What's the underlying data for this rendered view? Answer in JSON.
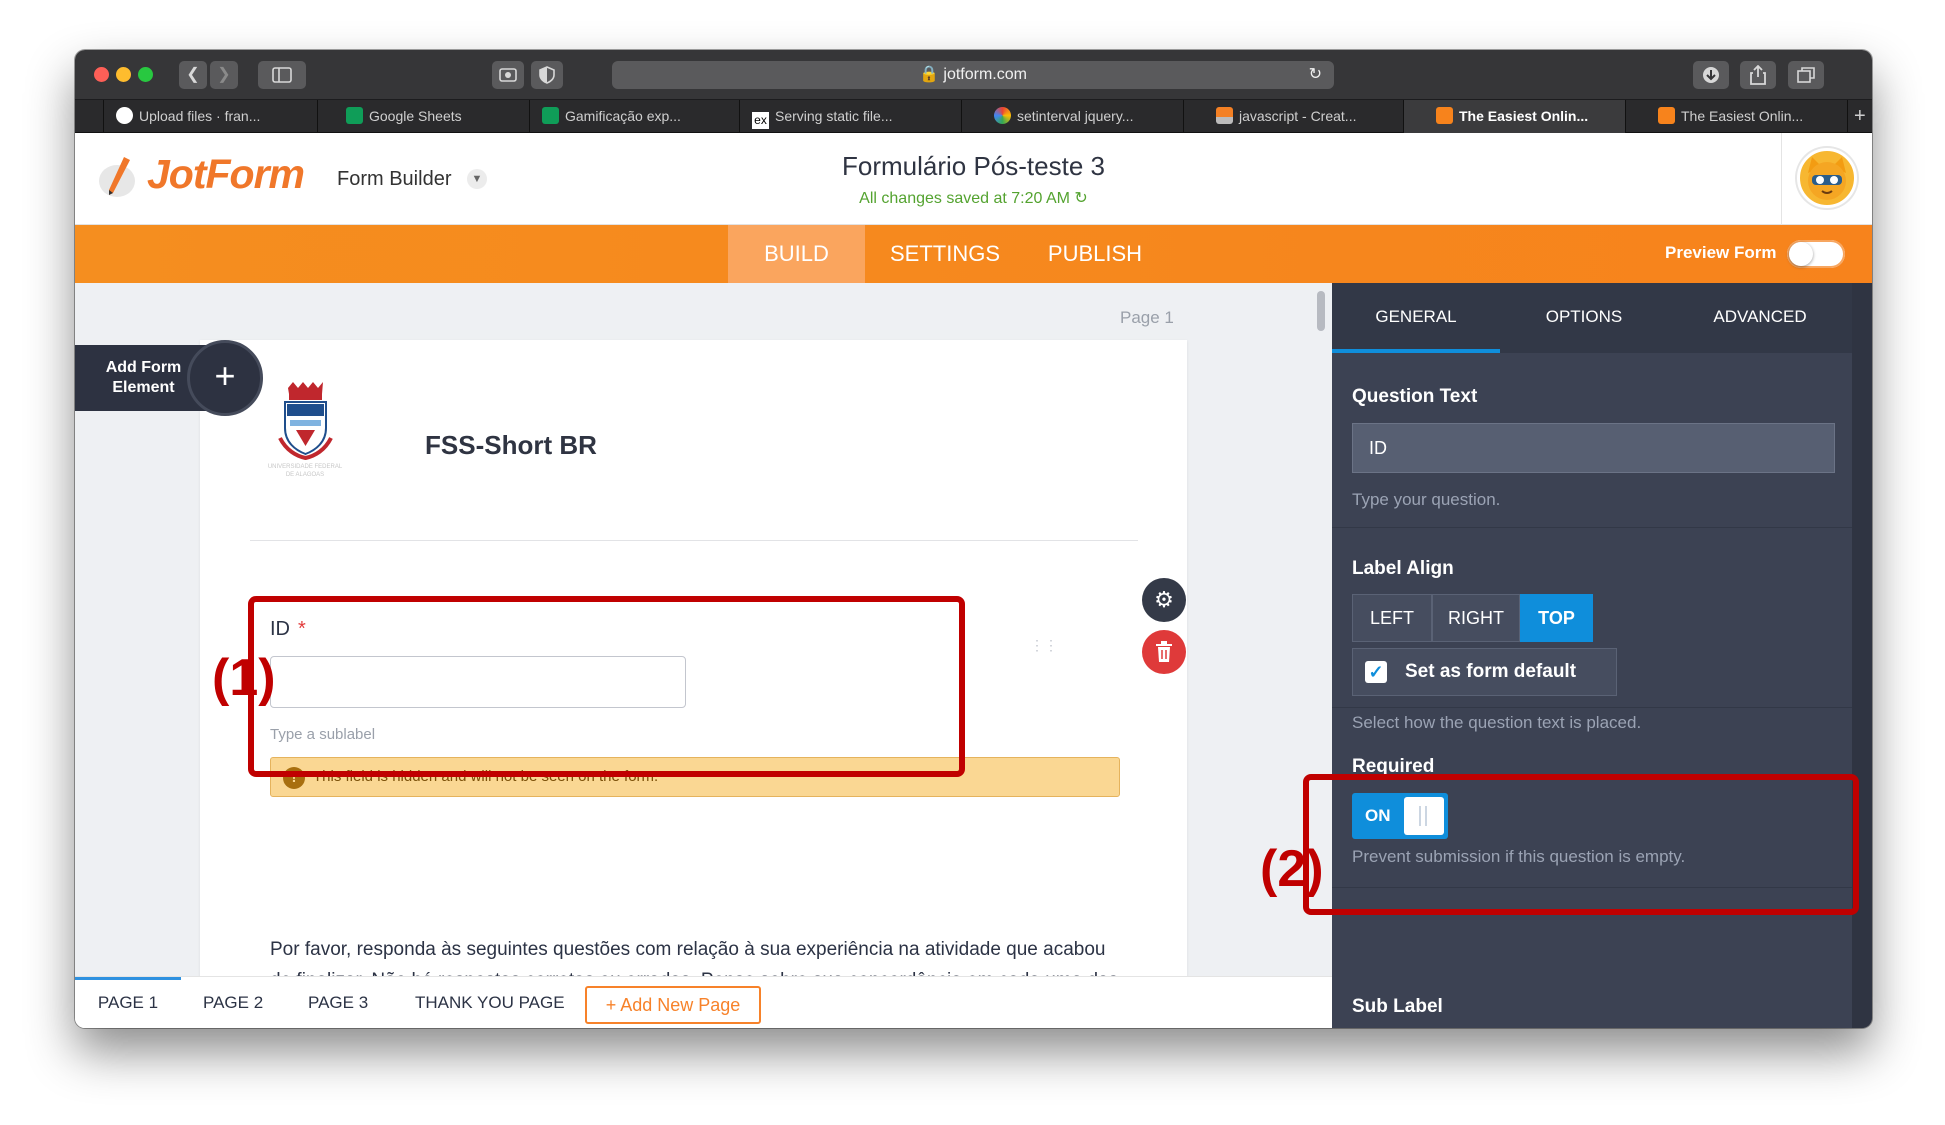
{
  "browser": {
    "url": "jotform.com",
    "tabs": [
      {
        "label": "Upload files · fran...",
        "icon": "github-icon",
        "active": false
      },
      {
        "label": "Google Sheets",
        "icon": "google-sheets-icon",
        "active": false
      },
      {
        "label": "Gamificação exp...",
        "icon": "google-sheets-icon",
        "active": false
      },
      {
        "label": "Serving static file...",
        "icon": "express-icon",
        "active": false
      },
      {
        "label": "setinterval jquery...",
        "icon": "pinwheel-icon",
        "active": false
      },
      {
        "label": "javascript - Creat...",
        "icon": "stackoverflow-icon",
        "active": false
      },
      {
        "label": "The Easiest Onlin...",
        "icon": "jotform-icon",
        "active": true
      },
      {
        "label": "The Easiest Onlin...",
        "icon": "jotform-icon",
        "active": false
      }
    ]
  },
  "header": {
    "logo_text": "JotForm",
    "builder_menu": "Form Builder",
    "form_title": "Formulário Pós-teste 3",
    "saved_status": "All changes saved at 7:20 AM"
  },
  "nav": {
    "tabs": [
      "BUILD",
      "SETTINGS",
      "PUBLISH"
    ],
    "active_tab": "BUILD",
    "preview_label": "Preview Form",
    "preview_on": false
  },
  "canvas": {
    "page_label": "Page 1",
    "add_element_label": "Add Form Element",
    "form_heading": "FSS-Short BR",
    "question": {
      "label": "ID",
      "required_mark": "*",
      "sublabel_placeholder": "Type a sublabel",
      "hidden_notice": "This field is hidden and will not be seen on the form."
    },
    "paragraph": "Por favor, responda às seguintes questões com relação à sua experiência na atividade que acabou de finalizar. Não há respostas corretas ou erradas. Pense sobre sua concordância em cada uma das exigências e então marque o número que melhor representa sua",
    "pages": [
      "PAGE 1",
      "PAGE 2",
      "PAGE 3",
      "THANK YOU PAGE"
    ],
    "active_page": "PAGE 1",
    "add_page_label": "+ Add New Page"
  },
  "panel": {
    "tabs": [
      "GENERAL",
      "OPTIONS",
      "ADVANCED"
    ],
    "active_tab": "GENERAL",
    "question_text": {
      "label": "Question Text",
      "value": "ID",
      "help": "Type your question."
    },
    "label_align": {
      "label": "Label Align",
      "options": [
        "LEFT",
        "RIGHT",
        "TOP"
      ],
      "selected": "TOP",
      "default_checkbox": "Set as form default",
      "default_checked": true,
      "help": "Select how the question text is placed."
    },
    "required": {
      "label": "Required",
      "state": "ON",
      "help": "Prevent submission if this question is empty."
    },
    "sub_label": {
      "label": "Sub Label"
    }
  },
  "annotations": {
    "first": "(1)",
    "second": "(2)"
  },
  "colors": {
    "brand_orange": "#f7831c",
    "accent_blue": "#0f8edb",
    "annotation_red": "#c00000",
    "panel_bg": "#3c4253"
  }
}
